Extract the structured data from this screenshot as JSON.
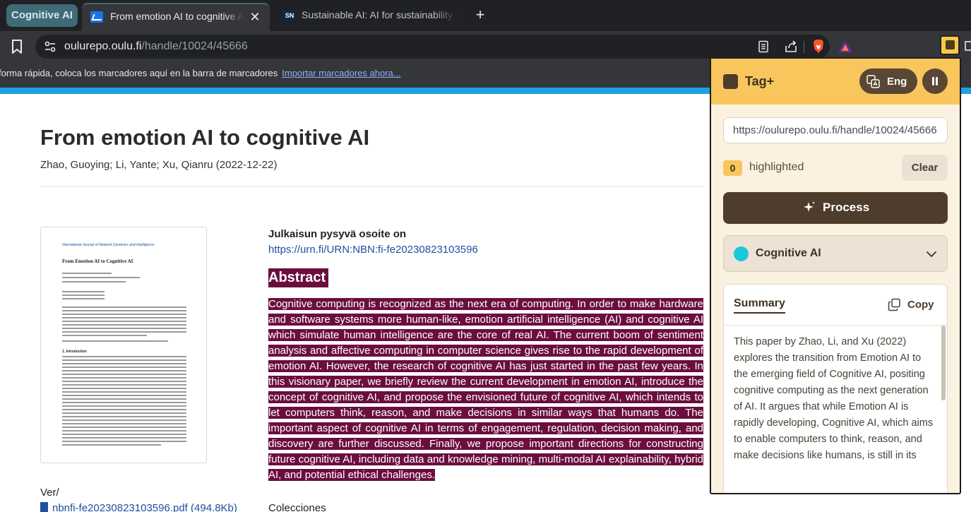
{
  "browser": {
    "tab_group": "Cognitive AI",
    "tabs": [
      {
        "title": "From emotion AI to cognitive AI",
        "active": true
      },
      {
        "title": "Sustainable AI: AI for sustainability and the sustainability of AI",
        "favicon_text": "SN",
        "active": false
      }
    ],
    "close_glyph": "✕",
    "new_tab_glyph": "+",
    "url_host": "oulurepo.oulu.fi",
    "url_path": "/handle/10024/45666",
    "bookmarks_message": "forma rápida, coloca los marcadores aquí en la barra de marcadores",
    "bookmarks_import_link": "Importar marcadores ahora..."
  },
  "page": {
    "title": "From emotion AI to cognitive AI",
    "authors": "Zhao, Guoying; Li, Yante; Xu, Qianru (2022-12-22)",
    "thumbnail": {
      "journal": "International Journal of Network Dynamics and Intelligence",
      "paper_title": "From Emotion AI to Cognitive AI",
      "section": "1. Introduction"
    },
    "persistent_id_label": "Julkaisun pysyvä osoite on",
    "persistent_id_link": "https://urn.fi/URN:NBN:fi-fe20230823103596",
    "abstract_heading": "Abstract",
    "abstract_text": "Cognitive computing is recognized as the next era of computing. In order to make hardware and software systems more human-like, emotion artificial intelligence (AI) and cognitive AI which simulate human intelligence are the core of real AI. The current boom of sentiment analysis and affective computing in computer science gives rise to the rapid development of emotion AI. However, the research of cognitive AI has just started in the past few years. In this visionary paper, we briefly review the current development in emotion AI, introduce the concept of cognitive AI, and propose the envisioned future of cognitive AI, which intends to let computers think, reason, and make decisions in similar ways that humans do. The important aspect of cognitive AI in terms of engagement, regulation, decision making, and discovery are further discussed. Finally, we propose important directions for constructing future cognitive AI, including data and knowledge mining, multi-modal AI explainability, hybrid AI, and potential ethical challenges.",
    "version_label": "Ver/",
    "pdf_link": "nbnfi-fe20230823103596.pdf (494.8Kb)",
    "collections_label": "Colecciones"
  },
  "tagplus": {
    "title": "Tag+",
    "language": "Eng",
    "url_value": "https://oulurepo.oulu.fi/handle/10024/45666",
    "highlighted_count": "0",
    "highlighted_label": "highlighted",
    "clear_label": "Clear",
    "process_label": "Process",
    "selected_tag": "Cognitive AI",
    "tag_color": "#1cc6de",
    "summary_tab": "Summary",
    "copy_label": "Copy",
    "summary_text": "This paper by Zhao, Li, and Xu (2022) explores the transition from Emotion AI to the emerging field of Cognitive AI, positing cognitive computing as the next generation of AI. It argues that while Emotion AI is rapidly developing, Cognitive AI, which aims to enable computers to think, reason, and make decisions like humans, is still in its"
  },
  "colors": {
    "accent_bar": "#1da1e6",
    "highlight": "#6b0e3f",
    "panel_header": "#f8c65c",
    "panel_dark": "#4e3d2c"
  }
}
